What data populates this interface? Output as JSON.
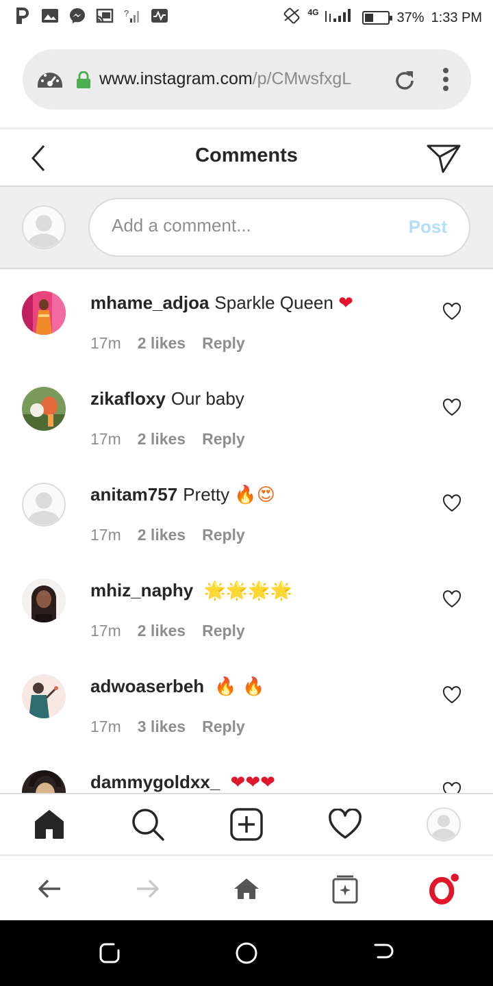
{
  "status_bar": {
    "left_icons": [
      "p-app-icon",
      "image-icon",
      "messenger-icon",
      "cast-icon",
      "no-signal-icon",
      "activity-icon"
    ],
    "network": "4G",
    "battery": "37%",
    "battery_level": 0.37,
    "time": "1:33 PM"
  },
  "browser": {
    "url_host": "www.instagram.com",
    "url_path": "/p/CMwsfxgL"
  },
  "header": {
    "title": "Comments"
  },
  "composer": {
    "placeholder": "Add a comment...",
    "post_label": "Post"
  },
  "comments": [
    {
      "username": "mhame_adjoa",
      "text": "Sparkle Queen",
      "emoji": "❤",
      "time": "17m",
      "likes": "2 likes",
      "reply": "Reply"
    },
    {
      "username": "zikafloxy",
      "text": "Our baby",
      "emoji": "",
      "time": "17m",
      "likes": "2 likes",
      "reply": "Reply"
    },
    {
      "username": "anitam757",
      "text": "Pretty",
      "emoji": "🔥😍",
      "time": "17m",
      "likes": "2 likes",
      "reply": "Reply"
    },
    {
      "username": "mhiz_naphy",
      "text": "",
      "emoji": "🌟🌟🌟🌟",
      "time": "17m",
      "likes": "2 likes",
      "reply": "Reply"
    },
    {
      "username": "adwoaserbeh",
      "text": "",
      "emoji": "🔥 🔥",
      "time": "17m",
      "likes": "3 likes",
      "reply": "Reply"
    },
    {
      "username": "dammygoldxx_",
      "text": "",
      "emoji": "❤❤❤",
      "time": "",
      "likes": "",
      "reply": ""
    }
  ],
  "colors": {
    "post_disabled": "#b2dffc",
    "heart_red": "#e0162b",
    "opera_red": "#e0162b"
  }
}
